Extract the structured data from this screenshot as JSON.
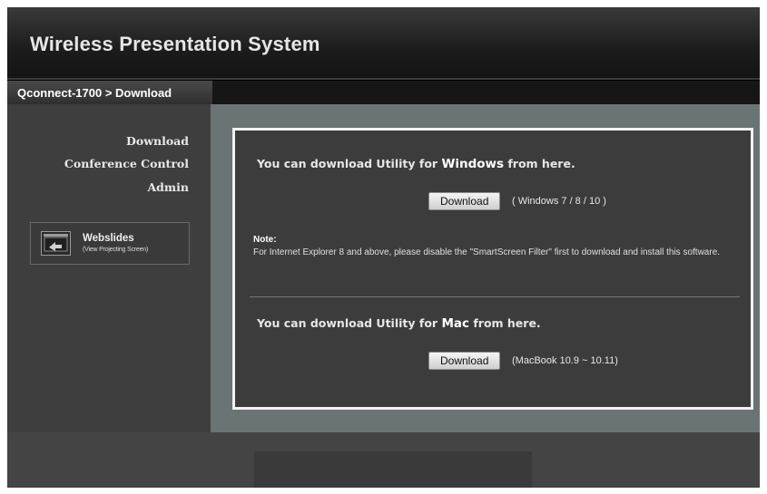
{
  "header": {
    "title": "Wireless Presentation System"
  },
  "breadcrumb": "Qconnect-1700 > Download",
  "sidebar": {
    "items": [
      {
        "label": "Download"
      },
      {
        "label": "Conference Control"
      },
      {
        "label": "Admin"
      }
    ],
    "webslides": {
      "title": "Webslides",
      "subtitle": "(View Projecting Screen)",
      "icon": "projector-screen-icon"
    }
  },
  "windows": {
    "heading_prefix": "You can download Utility for ",
    "os": "Windows",
    "heading_suffix": " from here.",
    "button_label": "Download",
    "versions": "( Windows 7 / 8 / 10 )"
  },
  "note": {
    "title": "Note:",
    "text": "For Internet Explorer 8 and above, please disable the \"SmartScreen Filter\" first to download and install this software."
  },
  "mac": {
    "heading_prefix": "You can download Utility for ",
    "os": "Mac",
    "heading_suffix": " from here.",
    "button_label": "Download",
    "versions": "(MacBook 10.9 ~ 10.11)"
  }
}
